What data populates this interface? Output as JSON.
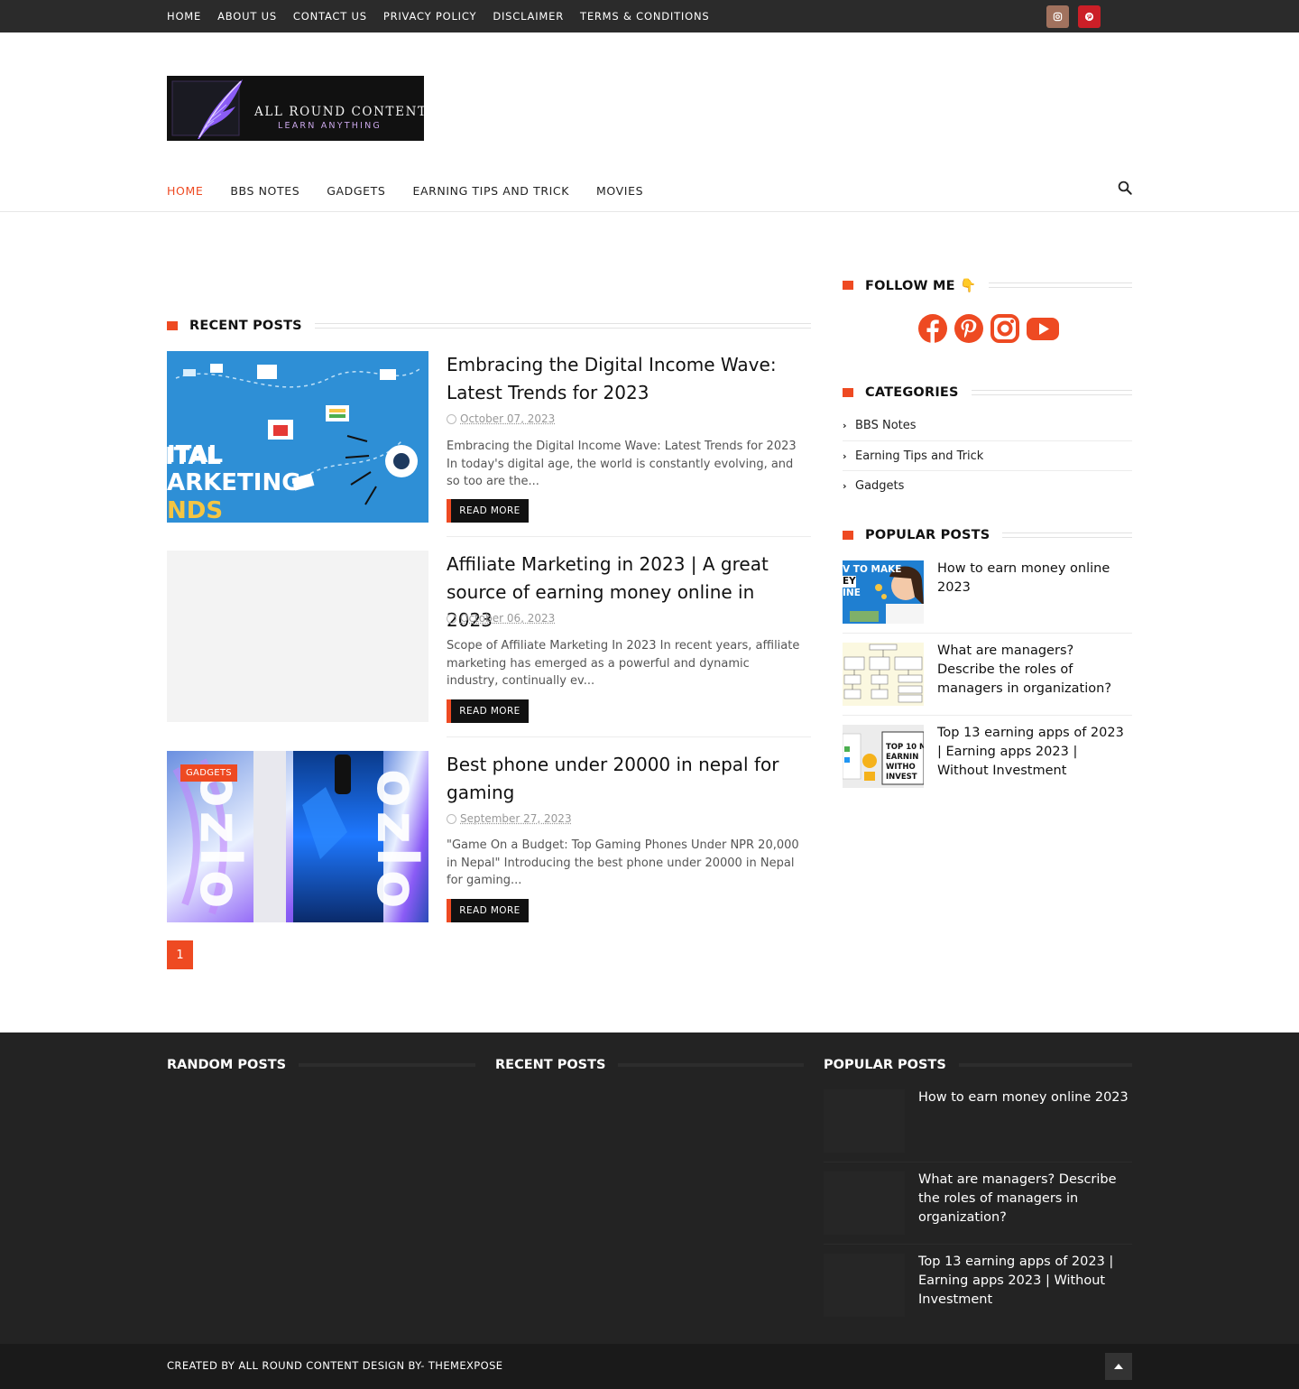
{
  "top_nav": [
    "HOME",
    "ABOUT US",
    "CONTACT US",
    "PRIVACY POLICY",
    "DISCLAIMER",
    "TERMS & CONDITIONS"
  ],
  "top_social": [
    {
      "icon": "instagram-icon",
      "color": "#a1725e"
    },
    {
      "icon": "pinterest-icon",
      "color": "#cb1f27"
    }
  ],
  "logo": {
    "line1": "ALL ROUND CONTENT",
    "line2": "LEARN ANYTHING"
  },
  "main_nav": [
    "HOME",
    "BBS NOTES",
    "GADGETS",
    "EARNING TIPS AND TRICK",
    "MOVIES"
  ],
  "accent_color": "#ee4a22",
  "recent_posts": {
    "heading": "Recent Posts",
    "read_more": "READ MORE",
    "posts": [
      {
        "title": "Embracing the Digital Income Wave: Latest Trends for 2023",
        "date": "October 07, 2023",
        "excerpt": "  Embracing the Digital Income Wave: Latest Trends for 2023 In today's digital age, the world is constantly evolving, and so too are the..."
      },
      {
        "title": "Affiliate Marketing in 2023 | A great source of earning money online in 2023",
        "date": "October 06, 2023",
        "excerpt": "  Scope of Affiliate Marketing In 2023 In recent years, affiliate marketing has emerged as a powerful and dynamic industry, continually ev..."
      },
      {
        "title": "Best phone under 20000 in nepal for gaming",
        "date": "September 27, 2023",
        "excerpt": "  \"Game On a Budget: Top Gaming Phones Under NPR 20,000 in Nepal\"   Introducing the best phone under 20000 in Nepal for gaming...",
        "category": "GADGETS"
      }
    ],
    "thumb1_text": [
      "ITAL",
      "ARKETING",
      "NDS"
    ],
    "thumb3_text": "ozlo"
  },
  "pagination": {
    "current": "1"
  },
  "sidebar": {
    "follow_heading": "Follow Me 👇",
    "follow_icons": [
      "facebook-icon",
      "pinterest-icon",
      "instagram-icon",
      "youtube-icon"
    ],
    "categories_heading": "Categories",
    "categories": [
      "BBS Notes",
      "Earning Tips and Trick",
      "Gadgets"
    ],
    "popular_heading": "Popular Posts",
    "popular": [
      "How to earn money online 2023",
      "What are managers? Describe the roles of managers in organization?",
      "Top 13 earning apps of 2023 | Earning apps 2023 | Without Investment"
    ],
    "pop_thumb1_text": [
      "V TO MAKE",
      "EY",
      "INE"
    ],
    "pop_thumb3_text": [
      "TOP 10 M",
      "EARNIN",
      "WITHO",
      "INVEST"
    ]
  },
  "footer": {
    "random_heading": "Random Posts",
    "recent_heading": "Recent Posts",
    "popular_heading": "Popular Posts",
    "popular": [
      "How to earn money online 2023",
      "What are managers? Describe the roles of managers in organization?",
      "Top 13 earning apps of 2023 | Earning apps 2023 | Without Investment"
    ],
    "copyright": "CREATED BY ALL ROUND CONTENT DESIGN BY- THEMEXPOSE"
  }
}
